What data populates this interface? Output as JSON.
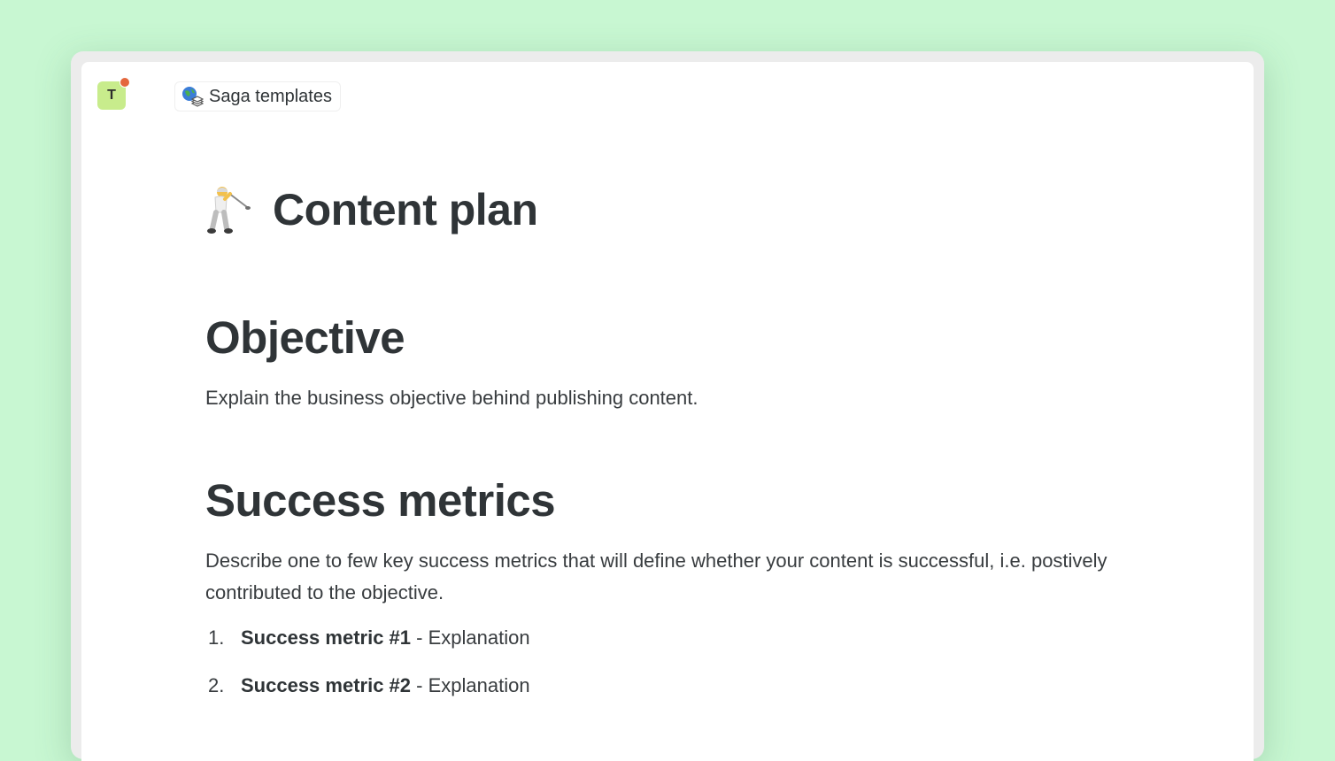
{
  "workspace": {
    "initial": "T"
  },
  "breadcrumb": {
    "label": "Saga templates",
    "icon": "globe-stack-icon"
  },
  "page": {
    "title": "Content plan",
    "title_icon": "golfer-emoji"
  },
  "sections": {
    "objective": {
      "heading": "Objective",
      "text": "Explain the business objective behind publishing content."
    },
    "success_metrics": {
      "heading": "Success metrics",
      "text": "Describe one to few key success metrics that will define whether your content is successful, i.e. postively contributed to the objective.",
      "items": [
        {
          "number": "1.",
          "bold": "Success metric #1",
          "rest": " - Explanation"
        },
        {
          "number": "2.",
          "bold": "Success metric #2",
          "rest": " - Explanation"
        }
      ]
    }
  },
  "colors": {
    "background": "#c8f7d2",
    "avatar": "#c8ec8c",
    "notification": "#e4673d",
    "text": "#2f3437"
  }
}
